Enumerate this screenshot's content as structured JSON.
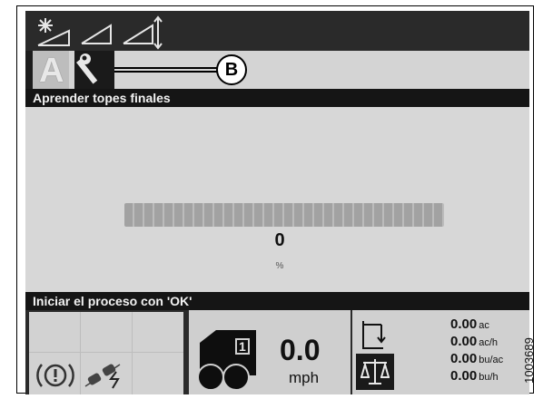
{
  "header": {
    "callout_label": "B"
  },
  "tabs": [
    {
      "label": "A",
      "icon": "auto-letter-icon"
    },
    {
      "icon": "wrench-icon"
    }
  ],
  "title_bar": "Aprender topes finales",
  "progress": {
    "value": "0",
    "unit": "%",
    "fraction": 0
  },
  "status_bar": "Iniciar el proceso con 'OK'",
  "vehicle": {
    "speed": "0.0",
    "speed_unit": "mph",
    "gear_label": "1"
  },
  "stats": [
    {
      "value": "0.00",
      "unit": "ac"
    },
    {
      "value": "0.00",
      "unit": "ac/h"
    },
    {
      "value": "0.00",
      "unit": "bu/ac"
    },
    {
      "value": "0.00",
      "unit": "bu/h"
    }
  ],
  "doc_id": "1003689",
  "colors": {
    "screen_bg": "#1d1d1d",
    "panel_bg": "#d7d7d7",
    "bar_text": "#f2f2f2"
  }
}
